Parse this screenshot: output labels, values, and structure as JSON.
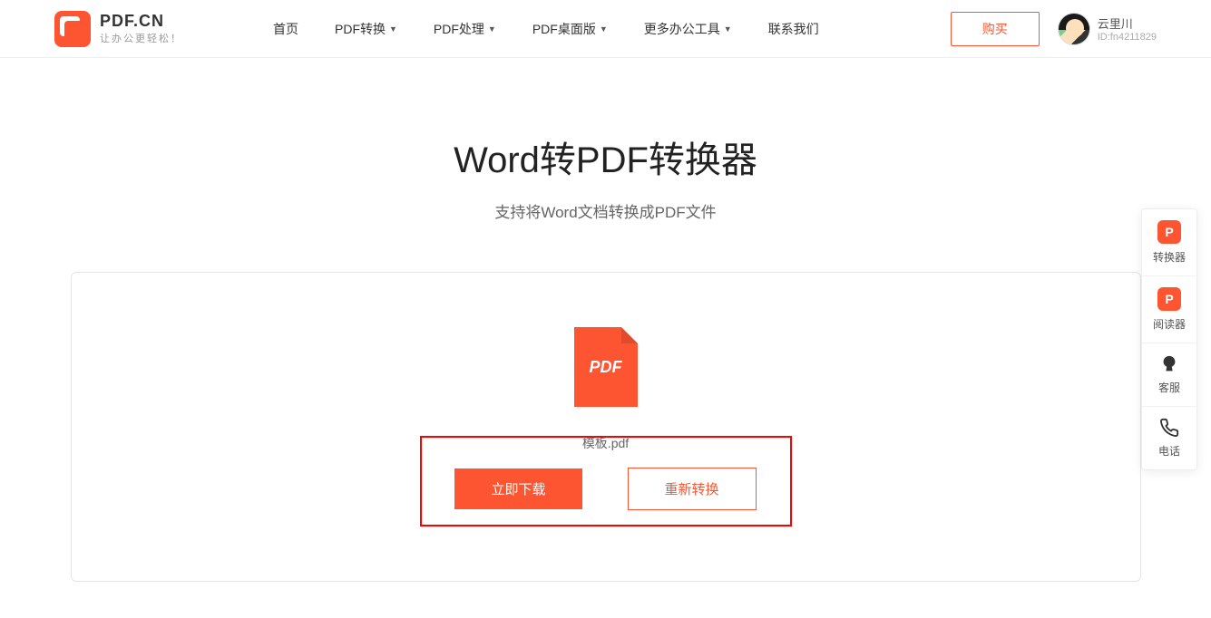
{
  "header": {
    "logo_title": "PDF.CN",
    "logo_sub": "让办公更轻松！",
    "nav": {
      "home": "首页",
      "convert": "PDF转换",
      "process": "PDF处理",
      "desktop": "PDF桌面版",
      "more_tools": "更多办公工具",
      "contact": "联系我们"
    },
    "buy_label": "购买",
    "user": {
      "name": "云里川",
      "id": "ID:fn4211829"
    }
  },
  "main": {
    "title": "Word转PDF转换器",
    "subtitle": "支持将Word文档转换成PDF文件",
    "file_badge": "PDF",
    "filename": "模板.pdf",
    "download_label": "立即下载",
    "reconvert_label": "重新转换"
  },
  "sidebar": {
    "items": [
      {
        "icon_text": "P",
        "label": "转换器"
      },
      {
        "icon_text": "P",
        "label": "阅读器"
      },
      {
        "label": "客服"
      },
      {
        "label": "电话"
      }
    ]
  }
}
